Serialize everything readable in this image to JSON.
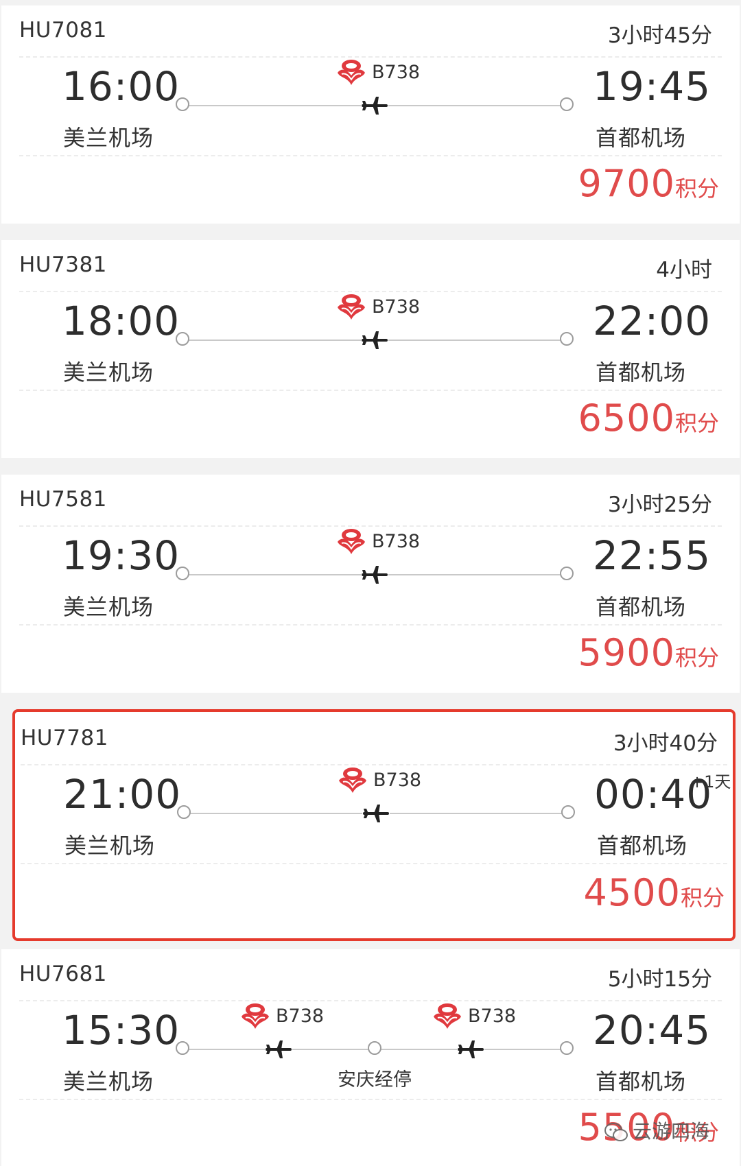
{
  "flights": [
    {
      "flight_no": "HU7081",
      "duration": "3小时45分",
      "dep_time": "16:00",
      "dep_airport": "美兰机场",
      "arr_time": "19:45",
      "arr_airport": "首都机场",
      "aircraft": "B738",
      "price": "9700",
      "price_unit": "积分"
    },
    {
      "flight_no": "HU7381",
      "duration": "4小时",
      "dep_time": "18:00",
      "dep_airport": "美兰机场",
      "arr_time": "22:00",
      "arr_airport": "首都机场",
      "aircraft": "B738",
      "price": "6500",
      "price_unit": "积分"
    },
    {
      "flight_no": "HU7581",
      "duration": "3小时25分",
      "dep_time": "19:30",
      "dep_airport": "美兰机场",
      "arr_time": "22:55",
      "arr_airport": "首都机场",
      "aircraft": "B738",
      "price": "5900",
      "price_unit": "积分"
    },
    {
      "flight_no": "HU7781",
      "duration": "3小时40分",
      "dep_time": "21:00",
      "dep_airport": "美兰机场",
      "arr_time": "00:40",
      "arr_day_offset": "+1天",
      "arr_airport": "首都机场",
      "aircraft": "B738",
      "price": "4500",
      "price_unit": "积分",
      "highlighted": true
    },
    {
      "flight_no": "HU7681",
      "duration": "5小时15分",
      "dep_time": "15:30",
      "dep_airport": "美兰机场",
      "arr_time": "20:45",
      "arr_airport": "首都机场",
      "aircraft": "B738",
      "aircraft_2": "B738",
      "stop": "安庆经停",
      "price": "5500",
      "price_unit": "积分"
    }
  ],
  "watermark": "云游四海",
  "colors": {
    "price": "#e04b4b",
    "highlight_border": "#e53a2c",
    "logo": "#e0393e"
  },
  "icons": {
    "airline_logo": "hainan-airlines-logo-icon",
    "plane": "airplane-icon",
    "node": "route-node-circle-icon"
  }
}
